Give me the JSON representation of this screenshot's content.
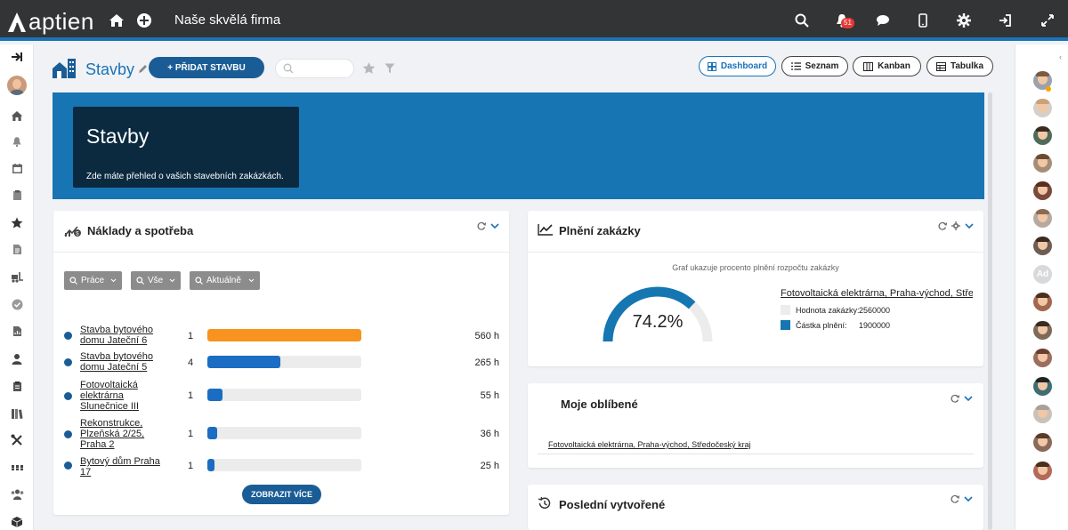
{
  "app": {
    "logo_text": "aptien",
    "company": "Naše skvělá firma",
    "notification_count": "51",
    "colors": {
      "topbar": "#333436",
      "accent": "#1a73b8",
      "banner": "#1775b4",
      "banner_card": "#0b2a40",
      "primary_button": "#1a5d96",
      "bar_orange": "#f7931e",
      "bar_blue": "#1a6dc3"
    },
    "topbar_icons": [
      "home-icon",
      "plus-circle-icon",
      "search-icon",
      "bell-icon",
      "chat-icon",
      "mobile-icon",
      "gear-icon",
      "logout-icon",
      "fullscreen-icon"
    ]
  },
  "page": {
    "title": "Stavby",
    "add_button": "+ PŘIDAT STAVBU",
    "search_placeholder": "",
    "views": [
      {
        "label": "Dashboard",
        "icon": "dashboard-icon",
        "active": true
      },
      {
        "label": "Seznam",
        "icon": "list-icon",
        "active": false
      },
      {
        "label": "Kanban",
        "icon": "kanban-icon",
        "active": false
      },
      {
        "label": "Tabulka",
        "icon": "table-icon",
        "active": false
      }
    ]
  },
  "banner": {
    "title": "Stavby",
    "subtitle": "Zde máte přehled o vašich stavebních zakázkách."
  },
  "costs": {
    "title": "Náklady a spotřeba",
    "filters": [
      "Práce",
      "Vše",
      "Aktuálně"
    ],
    "rows": [
      {
        "name": "Stavba bytového domu Jateční 6",
        "count": "1",
        "hours": "560 h",
        "value": 560,
        "color": "#f7931e"
      },
      {
        "name": "Stavba bytového domu Jateční 5",
        "count": "4",
        "hours": "265 h",
        "value": 265,
        "color": "#1a6dc3"
      },
      {
        "name": "Fotovoltaická elektrárna Slunečnice III",
        "count": "1",
        "hours": "55 h",
        "value": 55,
        "color": "#1a6dc3"
      },
      {
        "name": "Rekonstrukce, Plzeňská 2/25, Praha 2",
        "count": "1",
        "hours": "36 h",
        "value": 36,
        "color": "#1a6dc3"
      },
      {
        "name": "Bytový dům Praha 17",
        "count": "1",
        "hours": "25 h",
        "value": 25,
        "color": "#1a6dc3"
      }
    ],
    "more_button": "ZOBRAZIT VÍCE"
  },
  "fulfillment": {
    "title": "Plnění zakázky",
    "caption": "Graf ukazuje procento plnění rozpočtu zakázky",
    "value": "74.2%",
    "fraction": 0.742,
    "project": "Fotovoltaická elektrárna, Praha-východ, Středočeský kraj",
    "legend": [
      {
        "label": "Hodnota zakázky:",
        "value": "2560000",
        "color": "#ececec"
      },
      {
        "label": "Částka plnění:",
        "value": "1900000",
        "color": "#1676b2"
      }
    ]
  },
  "favorites": {
    "title": "Moje oblíbené",
    "items": [
      "Fotovoltaická elektrárna, Praha-východ, Středočeský kraj"
    ]
  },
  "recent": {
    "title": "Poslední vytvořené"
  },
  "sidebar_icons": [
    "arrow-right-icon",
    "user-avatar",
    "home-icon",
    "bell-icon",
    "calendar-icon",
    "clipboard-icon",
    "star-icon",
    "document-icon",
    "forklift-icon",
    "check-circle-icon",
    "report-icon",
    "person-icon",
    "clipboard-list-icon",
    "books-icon",
    "tools-icon",
    "apps-icon",
    "team-icon",
    "box-icon"
  ],
  "team": {
    "initials": "Ad"
  }
}
